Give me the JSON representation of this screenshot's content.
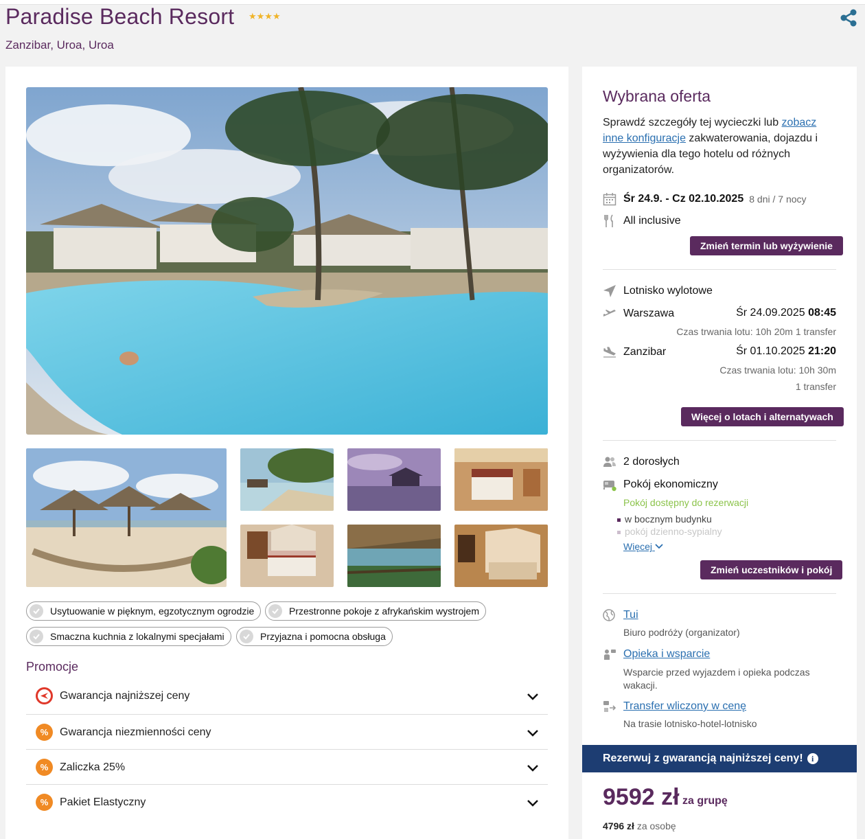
{
  "hotel": {
    "name": "Paradise Beach Resort",
    "stars": "★★★★",
    "location": "Zanzibar, Uroa, Uroa"
  },
  "features": [
    "Usytuowanie w pięknym, egzotycznym ogrodzie",
    "Przestronne pokoje z afrykańskim wystrojem",
    "Smaczna kuchnia z lokalnymi specjałami",
    "Przyjazna i pomocna obsługa"
  ],
  "promotions": {
    "title": "Promocje",
    "items": [
      {
        "label": "Gwarancja najniższej ceny",
        "icon": "price-guarantee-icon"
      },
      {
        "label": "Gwarancja niezmienności ceny",
        "icon": "percent-icon"
      },
      {
        "label": "Zaliczka 25%",
        "icon": "percent-icon"
      },
      {
        "label": "Pakiet Elastyczny",
        "icon": "percent-icon"
      }
    ]
  },
  "offer": {
    "title": "Wybrana oferta",
    "desc_before": "Sprawdź szczegóły tej wycieczki lub ",
    "desc_link": "zobacz inne konfiguracje",
    "desc_after": " zakwaterowania, dojazdu i wyżywienia dla tego hotelu od różnych organizatorów.",
    "dates": "Śr 24.9. - Cz 02.10.2025",
    "duration": "8 dni / 7 nocy",
    "board": "All inclusive",
    "change_term_button": "Zmień termin lub wyżywienie"
  },
  "flights": {
    "title": "Lotnisko wylotowe",
    "outbound": {
      "city": "Warszawa",
      "date": "Śr 24.09.2025",
      "time": "08:45",
      "info": "Czas trwania lotu: 10h 20m  1 transfer"
    },
    "return": {
      "city": "Zanzibar",
      "date": "Śr 01.10.2025",
      "time": "21:20",
      "info": "Czas trwania lotu: 10h 30m",
      "info2": "1 transfer"
    },
    "more_button": "Więcej o lotach i alternatywach"
  },
  "room": {
    "guests": "2 dorosłych",
    "type": "Pokój ekonomiczny",
    "availability": "Pokój dostępny do rezerwacji",
    "features": [
      "w bocznym budynku",
      "pokój dzienno-sypialny"
    ],
    "more_link": "Więcej",
    "change_button": "Zmień uczestników i pokój"
  },
  "organizer": {
    "name": "Tui",
    "name_desc": "Biuro podróży (organizator)",
    "support": "Opieka i wsparcie",
    "support_desc": "Wsparcie przed wyjazdem i opieka podczas wakacji.",
    "transfer": "Transfer wliczony w cenę",
    "transfer_desc": "Na trasie lotnisko-hotel-lotnisko"
  },
  "booking": {
    "banner": "Rezerwuj z gwarancją najniższej ceny!",
    "price": "9592 zł",
    "price_unit": "za grupę",
    "per_person_price": "4796 zł",
    "per_person_label": "za osobę"
  },
  "colors": {
    "brand": "#5a2a5e",
    "link": "#2a6fb0",
    "banner": "#1d3d72",
    "available": "#8bc34a",
    "promo_orange": "#f08a24",
    "star": "#f0b429"
  }
}
